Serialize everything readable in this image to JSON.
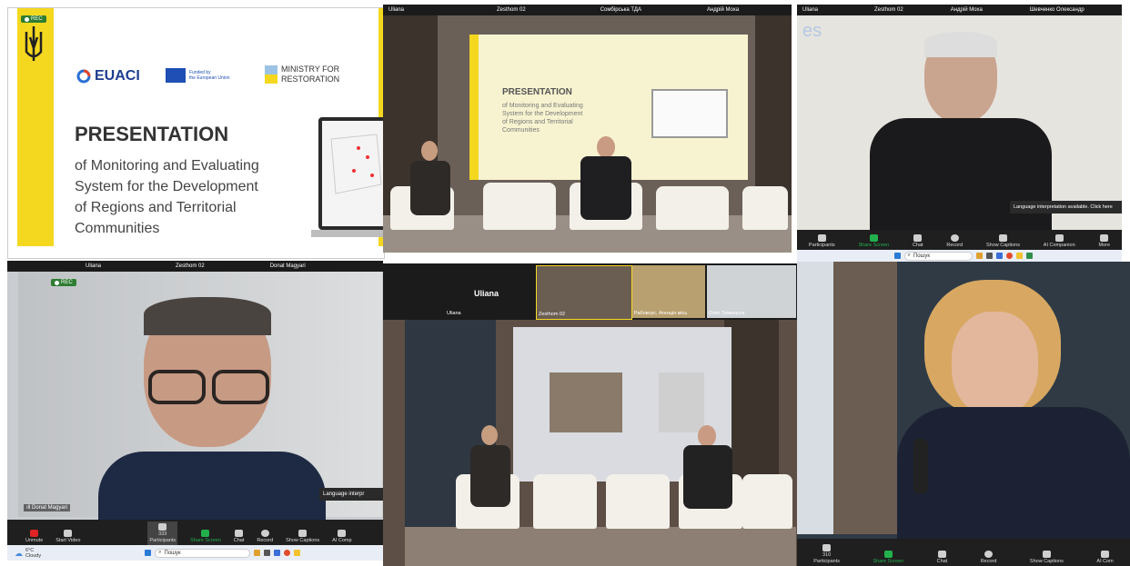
{
  "slide": {
    "rec": "REC",
    "euaci": "EUACI",
    "funded_by": "Funded by",
    "eu": "the European Union",
    "ministry": "MINISTRY FOR",
    "restoration": "RESTORATION",
    "title": "PRESENTATION",
    "subtitle_lines": [
      "of Monitoring and Evaluating",
      "System for the Development",
      "of Regions and Territorial",
      "Communities"
    ]
  },
  "panel2": {
    "names": [
      "Uliana",
      "Zesthom 02",
      "Сомбірська ТДА",
      "Андрій Моха"
    ],
    "screen_title": "PRESENTATION",
    "screen_sub": [
      "of Monitoring and Evaluating",
      "System for the Development",
      "of Regions and Territorial",
      "Communities"
    ]
  },
  "panel3": {
    "names": [
      "Uliana",
      "Zesthom 02",
      "Андрій Моха",
      "Шевченко Олександр"
    ],
    "es": "es",
    "lang": "Language interpretation available. Click here",
    "toolbar": [
      "Participants",
      "Share Screen",
      "Chat",
      "Record",
      "Show Captions",
      "AI Companion",
      "More"
    ],
    "search": "Пошук"
  },
  "panel4": {
    "names": [
      "Uliana",
      "Zesthom 02",
      "Donat Magyari"
    ],
    "speaker": "Donat Magyari",
    "lang": "Language interpr",
    "toolbar": [
      "Unmute",
      "Start Video",
      "Participants",
      "Share Screen",
      "Chat",
      "Record",
      "Show Captions",
      "AI Comp"
    ],
    "participants_count": "333",
    "weather_temp": "6°C",
    "weather_desc": "Cloudy",
    "search": "Пошук"
  },
  "panel5": {
    "host": "Uliana",
    "tiles": [
      "Uliana",
      "Zesthom 02",
      "Рабовоус, Агенція місь",
      "Олег Тимкешта"
    ]
  },
  "panel6": {
    "participants_count": "310",
    "toolbar": [
      "Participants",
      "Share Screen",
      "Chat",
      "Record",
      "Show Captions",
      "AI Com"
    ]
  },
  "colors": {
    "yellow": "#f4d81f",
    "zoom_bg": "#1f1f1f",
    "green": "#22b14c",
    "rec_red": "#e02424"
  }
}
